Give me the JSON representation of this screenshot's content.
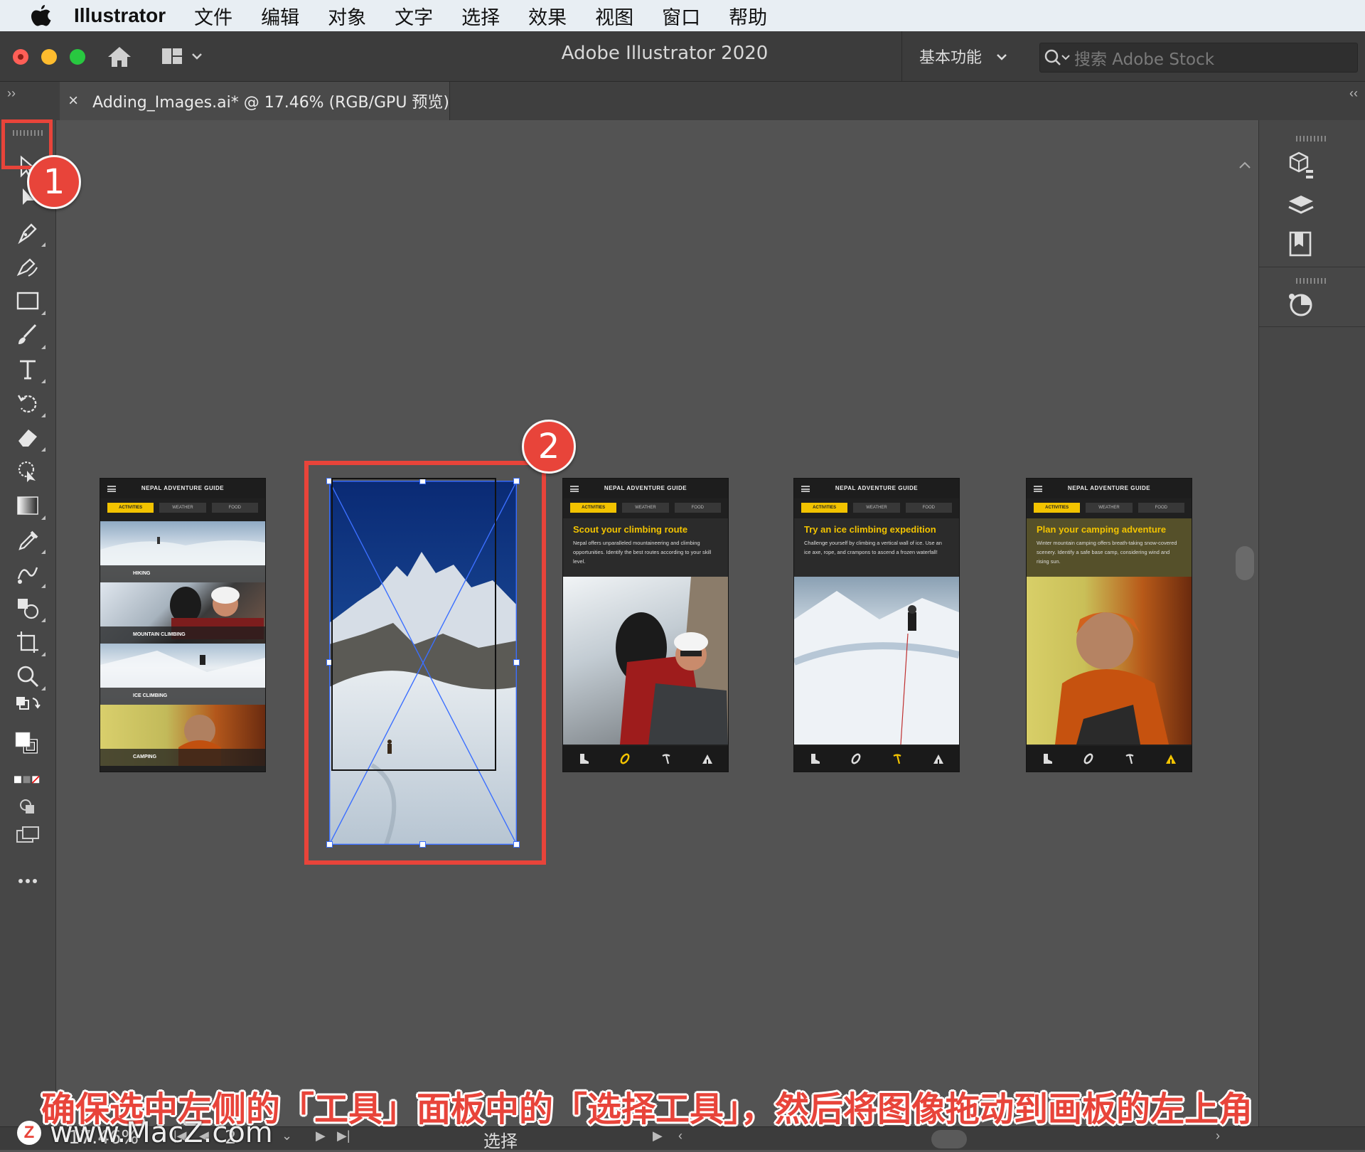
{
  "menubar": {
    "app_name": "Illustrator",
    "items": [
      "文件",
      "编辑",
      "对象",
      "文字",
      "选择",
      "效果",
      "视图",
      "窗口",
      "帮助"
    ]
  },
  "window": {
    "title": "Adobe Illustrator 2020",
    "workspace": "基本功能",
    "search_placeholder": "搜索 Adobe Stock"
  },
  "doc_tab": {
    "close": "×",
    "title": "Adding_Images.ai* @ 17.46% (RGB/GPU 预览)"
  },
  "annotations": {
    "badge1": "1",
    "badge2": "2",
    "highlight_color": "#e8443a",
    "caption": "确保选中左侧的「工具」面板中的「选择工具」，然后将图像拖动到画板的左上角"
  },
  "artboards": [
    {
      "header": "NEPAL ADVENTURE GUIDE",
      "tabs": [
        "ACTIVITIES",
        "WEATHER",
        "FOOD"
      ],
      "list": [
        "HIKING",
        "MOUNTAIN CLIMBING",
        "ICE CLIMBING",
        "CAMPING"
      ]
    },
    {
      "header": "NEPAL ADVENTURE GUIDE",
      "tabs": [
        "ACTIVITIES",
        "WEATHER",
        "FOOD"
      ],
      "heading": "Scout your climbing route",
      "body": "Nepal offers unparalleled mountaineering and climbing opportunities. Identify the best routes according to your skill level."
    },
    {
      "header": "NEPAL ADVENTURE GUIDE",
      "tabs": [
        "ACTIVITIES",
        "WEATHER",
        "FOOD"
      ],
      "heading": "Try an ice climbing expedition",
      "body": "Challenge yourself by climbing a vertical wall of ice. Use an ice axe, rope, and crampons to ascend a frozen waterfall!"
    },
    {
      "header": "NEPAL ADVENTURE GUIDE",
      "tabs": [
        "ACTIVITIES",
        "WEATHER",
        "FOOD"
      ],
      "heading": "Plan your camping adventure",
      "body": "Winter mountain camping offers breath-taking snow-covered scenery. Identify a safe base camp, considering wind and rising sun."
    }
  ],
  "statusbar": {
    "zoom": "17.46%",
    "artboard_num": "2",
    "tool_status": "选择"
  },
  "watermark": {
    "logo": "Z",
    "text": "www.MacZ.com"
  },
  "colors": {
    "accent_yellow": "#f2c300",
    "selection_blue": "#3b6fff"
  }
}
